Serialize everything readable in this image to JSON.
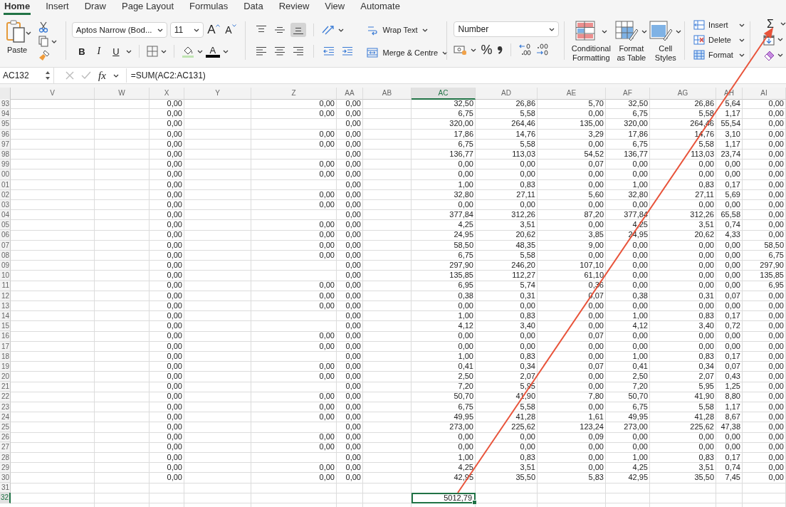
{
  "tabs": [
    {
      "label": "Home",
      "selected": true
    },
    {
      "label": "Insert",
      "selected": false
    },
    {
      "label": "Draw",
      "selected": false
    },
    {
      "label": "Page Layout",
      "selected": false
    },
    {
      "label": "Formulas",
      "selected": false
    },
    {
      "label": "Data",
      "selected": false
    },
    {
      "label": "Review",
      "selected": false
    },
    {
      "label": "View",
      "selected": false
    },
    {
      "label": "Automate",
      "selected": false
    }
  ],
  "ribbon": {
    "clipboard": {
      "paste": "Paste"
    },
    "font": {
      "name": "Aptos Narrow (Bod...",
      "size": "11",
      "grow": "A",
      "shrink": "A",
      "bold": "B",
      "italic": "I",
      "underline": "U",
      "color_letter": "A"
    },
    "alignment": {
      "vertical": [
        {
          "kind": "top",
          "selected": false
        },
        {
          "kind": "middle",
          "selected": false
        },
        {
          "kind": "bottom",
          "selected": true
        }
      ],
      "wrap_text": "Wrap Text",
      "merge": "Merge & Centre"
    },
    "number": {
      "format": "Number",
      "percent": "%"
    },
    "styles": [
      {
        "kind": "conditional",
        "label": "Conditional Formatting"
      },
      {
        "kind": "table",
        "label": "Format as Table"
      },
      {
        "kind": "cell",
        "label": "Cell Styles"
      }
    ],
    "cells": [
      {
        "kind": "insert",
        "label": "Insert"
      },
      {
        "kind": "delete",
        "label": "Delete"
      },
      {
        "kind": "format",
        "label": "Format"
      }
    ],
    "editing": {
      "sum": "Σ"
    }
  },
  "formula_bar": {
    "name_box": "AC132",
    "fx": "fx",
    "formula": "=SUM(AC2:AC131)"
  },
  "sheet": {
    "columns": [
      {
        "label": "V",
        "selected": false
      },
      {
        "label": "W",
        "selected": false
      },
      {
        "label": "X",
        "selected": false
      },
      {
        "label": "Y",
        "selected": false
      },
      {
        "label": "Z",
        "selected": false
      },
      {
        "label": "AA",
        "selected": false
      },
      {
        "label": "AB",
        "selected": false
      },
      {
        "label": "AC",
        "selected": true
      },
      {
        "label": "AD",
        "selected": false
      },
      {
        "label": "AE",
        "selected": false
      },
      {
        "label": "AF",
        "selected": false
      },
      {
        "label": "AG",
        "selected": false
      },
      {
        "label": "AH",
        "selected": false
      },
      {
        "label": "AI",
        "selected": false
      }
    ],
    "rows": [
      {
        "header": "93",
        "selected": false,
        "cells": [
          null,
          null,
          "0,00",
          null,
          "0,00",
          "0,00",
          null,
          "32,50",
          "26,86",
          "5,70",
          "32,50",
          "26,86",
          "5,64",
          "0,00"
        ]
      },
      {
        "header": "94",
        "selected": false,
        "cells": [
          null,
          null,
          "0,00",
          null,
          "0,00",
          "0,00",
          null,
          "6,75",
          "5,58",
          "0,00",
          "6,75",
          "5,58",
          "1,17",
          "0,00"
        ]
      },
      {
        "header": "95",
        "selected": false,
        "cells": [
          null,
          null,
          "0,00",
          null,
          null,
          "0,00",
          null,
          "320,00",
          "264,46",
          "135,00",
          "320,00",
          "264,46",
          "55,54",
          "0,00"
        ]
      },
      {
        "header": "96",
        "selected": false,
        "cells": [
          null,
          null,
          "0,00",
          null,
          "0,00",
          "0,00",
          null,
          "17,86",
          "14,76",
          "3,29",
          "17,86",
          "14,76",
          "3,10",
          "0,00"
        ]
      },
      {
        "header": "97",
        "selected": false,
        "cells": [
          null,
          null,
          "0,00",
          null,
          "0,00",
          "0,00",
          null,
          "6,75",
          "5,58",
          "0,00",
          "6,75",
          "5,58",
          "1,17",
          "0,00"
        ]
      },
      {
        "header": "98",
        "selected": false,
        "cells": [
          null,
          null,
          "0,00",
          null,
          null,
          "0,00",
          null,
          "136,77",
          "113,03",
          "54,52",
          "136,77",
          "113,03",
          "23,74",
          "0,00"
        ]
      },
      {
        "header": "99",
        "selected": false,
        "cells": [
          null,
          null,
          "0,00",
          null,
          "0,00",
          "0,00",
          null,
          "0,00",
          "0,00",
          "0,07",
          "0,00",
          "0,00",
          "0,00",
          "0,00"
        ]
      },
      {
        "header": "00",
        "selected": false,
        "cells": [
          null,
          null,
          "0,00",
          null,
          "0,00",
          "0,00",
          null,
          "0,00",
          "0,00",
          "0,00",
          "0,00",
          "0,00",
          "0,00",
          "0,00"
        ]
      },
      {
        "header": "01",
        "selected": false,
        "cells": [
          null,
          null,
          "0,00",
          null,
          null,
          "0,00",
          null,
          "1,00",
          "0,83",
          "0,00",
          "1,00",
          "0,83",
          "0,17",
          "0,00"
        ]
      },
      {
        "header": "02",
        "selected": false,
        "cells": [
          null,
          null,
          "0,00",
          null,
          "0,00",
          "0,00",
          null,
          "32,80",
          "27,11",
          "5,60",
          "32,80",
          "27,11",
          "5,69",
          "0,00"
        ]
      },
      {
        "header": "03",
        "selected": false,
        "cells": [
          null,
          null,
          "0,00",
          null,
          "0,00",
          "0,00",
          null,
          "0,00",
          "0,00",
          "0,00",
          "0,00",
          "0,00",
          "0,00",
          "0,00"
        ]
      },
      {
        "header": "04",
        "selected": false,
        "cells": [
          null,
          null,
          "0,00",
          null,
          null,
          "0,00",
          null,
          "377,84",
          "312,26",
          "87,20",
          "377,84",
          "312,26",
          "65,58",
          "0,00"
        ]
      },
      {
        "header": "05",
        "selected": false,
        "cells": [
          null,
          null,
          "0,00",
          null,
          "0,00",
          "0,00",
          null,
          "4,25",
          "3,51",
          "0,00",
          "4,25",
          "3,51",
          "0,74",
          "0,00"
        ]
      },
      {
        "header": "06",
        "selected": false,
        "cells": [
          null,
          null,
          "0,00",
          null,
          "0,00",
          "0,00",
          null,
          "24,95",
          "20,62",
          "3,85",
          "24,95",
          "20,62",
          "4,33",
          "0,00"
        ]
      },
      {
        "header": "07",
        "selected": false,
        "cells": [
          null,
          null,
          "0,00",
          null,
          "0,00",
          "0,00",
          null,
          "58,50",
          "48,35",
          "9,00",
          "0,00",
          "0,00",
          "0,00",
          "58,50"
        ]
      },
      {
        "header": "08",
        "selected": false,
        "cells": [
          null,
          null,
          "0,00",
          null,
          "0,00",
          "0,00",
          null,
          "6,75",
          "5,58",
          "0,00",
          "0,00",
          "0,00",
          "0,00",
          "6,75"
        ]
      },
      {
        "header": "09",
        "selected": false,
        "cells": [
          null,
          null,
          "0,00",
          null,
          null,
          "0,00",
          null,
          "297,90",
          "246,20",
          "107,10",
          "0,00",
          "0,00",
          "0,00",
          "297,90"
        ]
      },
      {
        "header": "10",
        "selected": false,
        "cells": [
          null,
          null,
          "0,00",
          null,
          null,
          "0,00",
          null,
          "135,85",
          "112,27",
          "61,10",
          "0,00",
          "0,00",
          "0,00",
          "135,85"
        ]
      },
      {
        "header": "11",
        "selected": false,
        "cells": [
          null,
          null,
          "0,00",
          null,
          "0,00",
          "0,00",
          null,
          "6,95",
          "5,74",
          "0,36",
          "0,00",
          "0,00",
          "0,00",
          "6,95"
        ]
      },
      {
        "header": "12",
        "selected": false,
        "cells": [
          null,
          null,
          "0,00",
          null,
          "0,00",
          "0,00",
          null,
          "0,38",
          "0,31",
          "0,07",
          "0,38",
          "0,31",
          "0,07",
          "0,00"
        ]
      },
      {
        "header": "13",
        "selected": false,
        "cells": [
          null,
          null,
          "0,00",
          null,
          "0,00",
          "0,00",
          null,
          "0,00",
          "0,00",
          "0,00",
          "0,00",
          "0,00",
          "0,00",
          "0,00"
        ]
      },
      {
        "header": "14",
        "selected": false,
        "cells": [
          null,
          null,
          "0,00",
          null,
          null,
          "0,00",
          null,
          "1,00",
          "0,83",
          "0,00",
          "1,00",
          "0,83",
          "0,17",
          "0,00"
        ]
      },
      {
        "header": "15",
        "selected": false,
        "cells": [
          null,
          null,
          "0,00",
          null,
          null,
          "0,00",
          null,
          "4,12",
          "3,40",
          "0,00",
          "4,12",
          "3,40",
          "0,72",
          "0,00"
        ]
      },
      {
        "header": "16",
        "selected": false,
        "cells": [
          null,
          null,
          "0,00",
          null,
          "0,00",
          "0,00",
          null,
          "0,00",
          "0,00",
          "0,07",
          "0,00",
          "0,00",
          "0,00",
          "0,00"
        ]
      },
      {
        "header": "17",
        "selected": false,
        "cells": [
          null,
          null,
          "0,00",
          null,
          "0,00",
          "0,00",
          null,
          "0,00",
          "0,00",
          "0,00",
          "0,00",
          "0,00",
          "0,00",
          "0,00"
        ]
      },
      {
        "header": "18",
        "selected": false,
        "cells": [
          null,
          null,
          "0,00",
          null,
          null,
          "0,00",
          null,
          "1,00",
          "0,83",
          "0,00",
          "1,00",
          "0,83",
          "0,17",
          "0,00"
        ]
      },
      {
        "header": "19",
        "selected": false,
        "cells": [
          null,
          null,
          "0,00",
          null,
          "0,00",
          "0,00",
          null,
          "0,41",
          "0,34",
          "0,07",
          "0,41",
          "0,34",
          "0,07",
          "0,00"
        ]
      },
      {
        "header": "20",
        "selected": false,
        "cells": [
          null,
          null,
          "0,00",
          null,
          "0,00",
          "0,00",
          null,
          "2,50",
          "2,07",
          "0,00",
          "2,50",
          "2,07",
          "0,43",
          "0,00"
        ]
      },
      {
        "header": "21",
        "selected": false,
        "cells": [
          null,
          null,
          "0,00",
          null,
          null,
          "0,00",
          null,
          "7,20",
          "5,95",
          "0,00",
          "7,20",
          "5,95",
          "1,25",
          "0,00"
        ]
      },
      {
        "header": "22",
        "selected": false,
        "cells": [
          null,
          null,
          "0,00",
          null,
          "0,00",
          "0,00",
          null,
          "50,70",
          "41,90",
          "7,80",
          "50,70",
          "41,90",
          "8,80",
          "0,00"
        ]
      },
      {
        "header": "23",
        "selected": false,
        "cells": [
          null,
          null,
          "0,00",
          null,
          "0,00",
          "0,00",
          null,
          "6,75",
          "5,58",
          "0,00",
          "6,75",
          "5,58",
          "1,17",
          "0,00"
        ]
      },
      {
        "header": "24",
        "selected": false,
        "cells": [
          null,
          null,
          "0,00",
          null,
          "0,00",
          "0,00",
          null,
          "49,95",
          "41,28",
          "1,61",
          "49,95",
          "41,28",
          "8,67",
          "0,00"
        ]
      },
      {
        "header": "25",
        "selected": false,
        "cells": [
          null,
          null,
          "0,00",
          null,
          null,
          "0,00",
          null,
          "273,00",
          "225,62",
          "123,24",
          "273,00",
          "225,62",
          "47,38",
          "0,00"
        ]
      },
      {
        "header": "26",
        "selected": false,
        "cells": [
          null,
          null,
          "0,00",
          null,
          "0,00",
          "0,00",
          null,
          "0,00",
          "0,00",
          "0,09",
          "0,00",
          "0,00",
          "0,00",
          "0,00"
        ]
      },
      {
        "header": "27",
        "selected": false,
        "cells": [
          null,
          null,
          "0,00",
          null,
          "0,00",
          "0,00",
          null,
          "0,00",
          "0,00",
          "0,00",
          "0,00",
          "0,00",
          "0,00",
          "0,00"
        ]
      },
      {
        "header": "28",
        "selected": false,
        "cells": [
          null,
          null,
          "0,00",
          null,
          null,
          "0,00",
          null,
          "1,00",
          "0,83",
          "0,00",
          "1,00",
          "0,83",
          "0,17",
          "0,00"
        ]
      },
      {
        "header": "29",
        "selected": false,
        "cells": [
          null,
          null,
          "0,00",
          null,
          "0,00",
          "0,00",
          null,
          "4,25",
          "3,51",
          "0,00",
          "4,25",
          "3,51",
          "0,74",
          "0,00"
        ]
      },
      {
        "header": "30",
        "selected": false,
        "cells": [
          null,
          null,
          "0,00",
          null,
          "0,00",
          "0,00",
          null,
          "42,95",
          "35,50",
          "5,83",
          "42,95",
          "35,50",
          "7,45",
          "0,00"
        ]
      },
      {
        "header": "31",
        "selected": false,
        "cells": [
          null,
          null,
          null,
          null,
          null,
          null,
          null,
          null,
          null,
          null,
          null,
          null,
          null,
          null
        ]
      },
      {
        "header": "32",
        "selected": true,
        "cells": [
          null,
          null,
          null,
          null,
          null,
          null,
          null,
          "5012,79",
          null,
          null,
          null,
          null,
          null,
          null
        ]
      }
    ]
  }
}
